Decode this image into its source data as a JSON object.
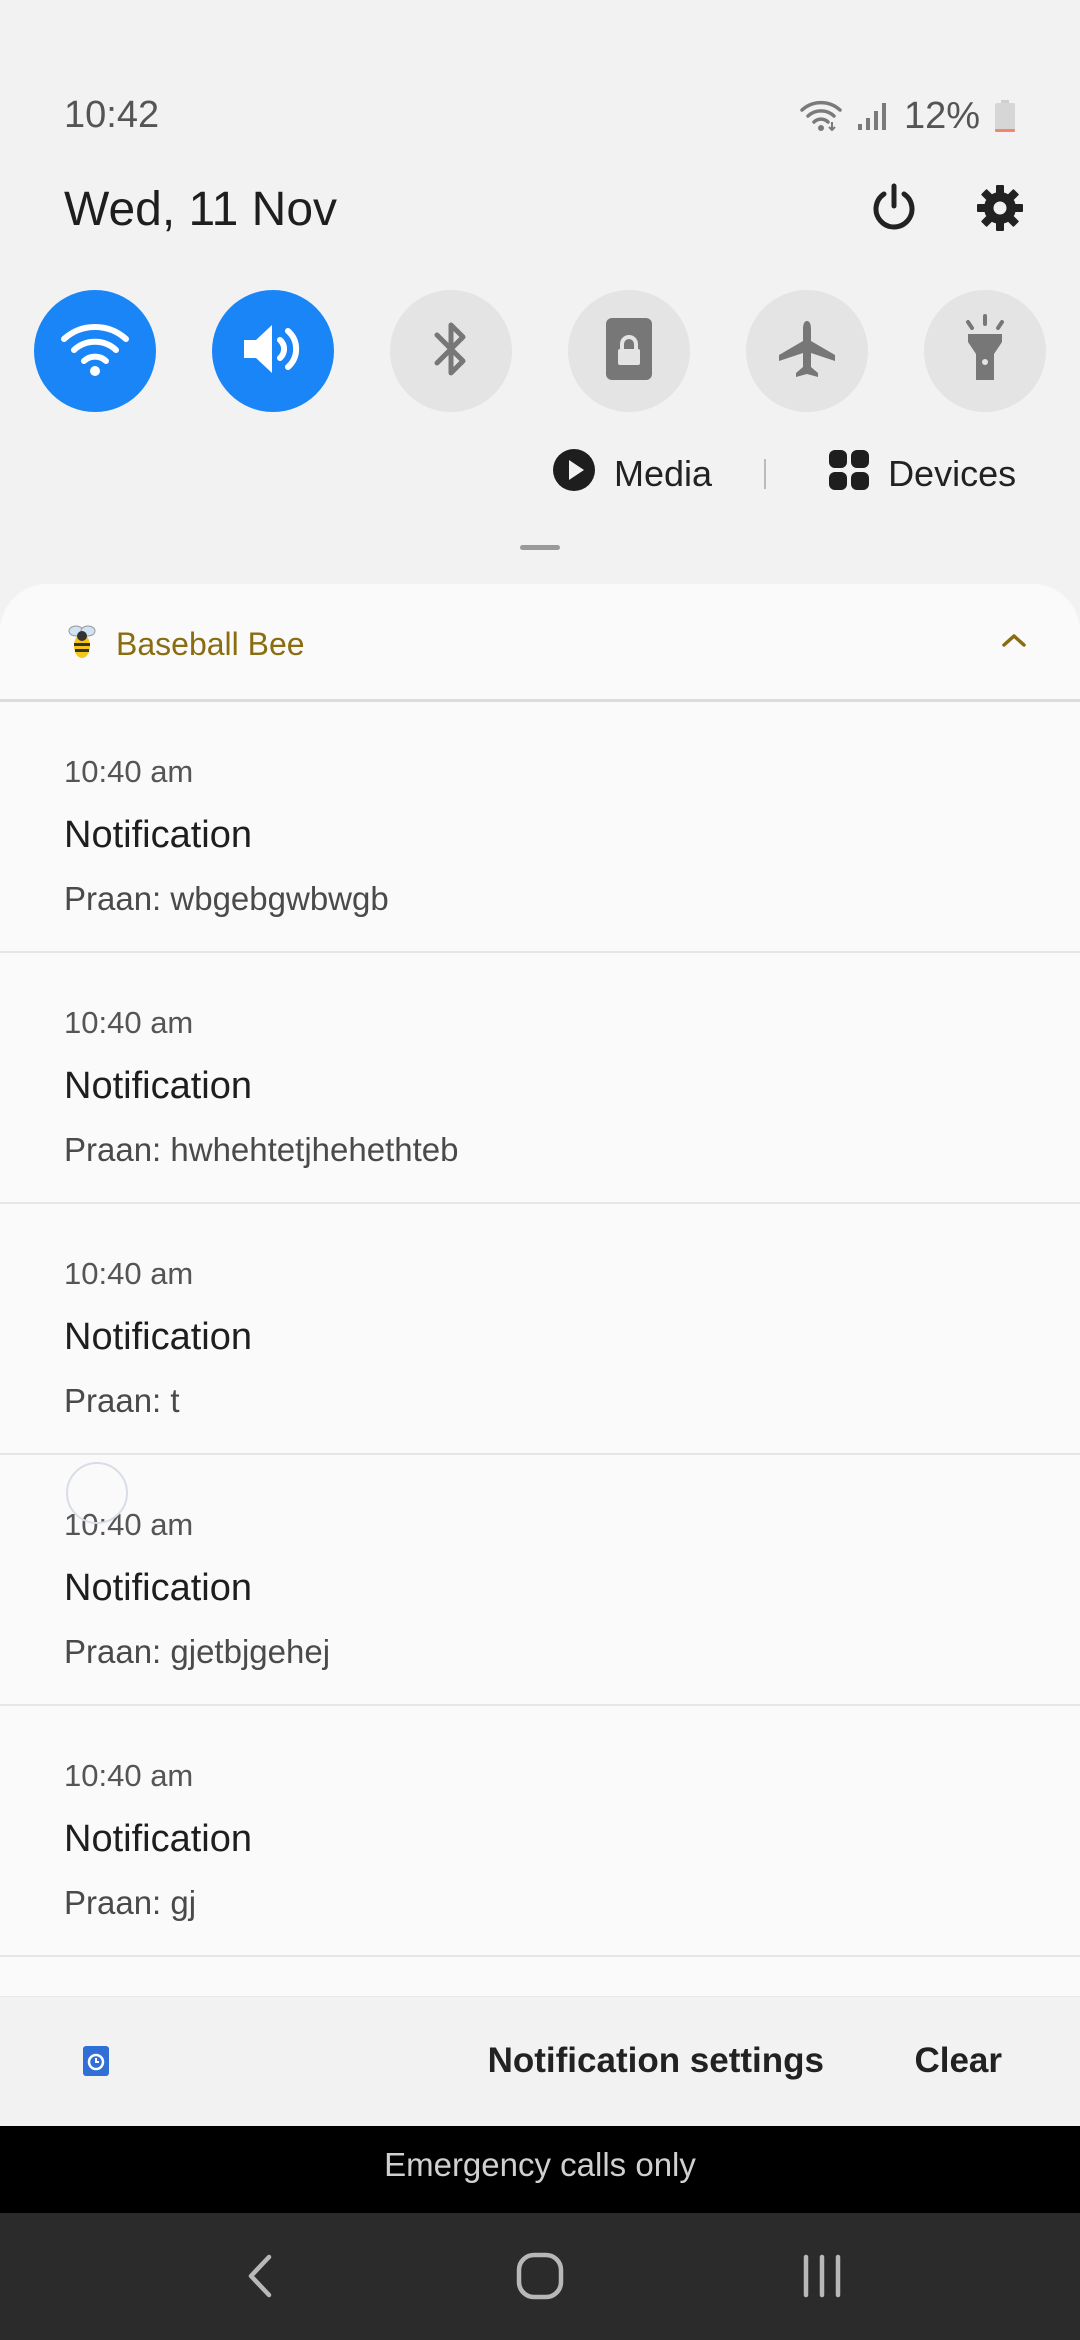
{
  "status_bar": {
    "time": "10:42",
    "battery_percent": "12%",
    "icons": [
      "wifi-icon",
      "signal-icon",
      "battery-icon"
    ],
    "battery_level": 0.12,
    "battery_color": "#f0876a"
  },
  "header": {
    "date": "Wed, 11 Nov",
    "icons": [
      "power-icon",
      "settings-icon"
    ]
  },
  "quick_settings": [
    {
      "name": "wifi",
      "icon": "wifi-icon",
      "active": true
    },
    {
      "name": "sound",
      "icon": "sound-icon",
      "active": true
    },
    {
      "name": "bluetooth",
      "icon": "bluetooth-icon",
      "active": false
    },
    {
      "name": "screen-lock",
      "icon": "lock-icon",
      "active": false
    },
    {
      "name": "airplane",
      "icon": "airplane-icon",
      "active": false
    },
    {
      "name": "flashlight",
      "icon": "flashlight-icon",
      "active": false
    }
  ],
  "media_devices": {
    "media_label": "Media",
    "devices_label": "Devices"
  },
  "notification_group": {
    "app_name": "Baseball Bee",
    "app_color": "#8a6d10",
    "notifications": [
      {
        "time": "10:40 am",
        "title": "Notification",
        "body": "Praan: wbgebgwbwgb"
      },
      {
        "time": "10:40 am",
        "title": "Notification",
        "body": "Praan: hwhehtetjhehethteb"
      },
      {
        "time": "10:40 am",
        "title": "Notification",
        "body": "Praan: t"
      },
      {
        "time": "10:40 am",
        "title": "Notification",
        "body": "Praan: gjetbjgehej"
      },
      {
        "time": "10:40 am",
        "title": "Notification",
        "body": "Praan: gj"
      }
    ]
  },
  "footer": {
    "settings_label": "Notification settings",
    "clear_label": "Clear"
  },
  "emergency_text": "Emergency calls only",
  "navigation": {
    "icons": [
      "back-icon",
      "home-icon",
      "recents-icon"
    ]
  },
  "colors": {
    "accent": "#1a85f6",
    "panel_bg": "#fafafa",
    "shade_bg": "#f2f2f2"
  }
}
